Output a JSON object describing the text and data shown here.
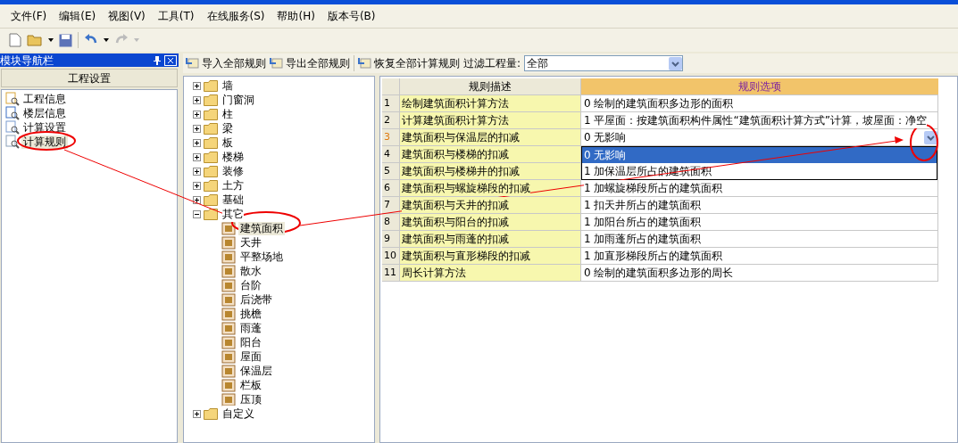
{
  "menu": [
    "文件(F)",
    "编辑(E)",
    "视图(V)",
    "工具(T)",
    "在线服务(S)",
    "帮助(H)",
    "版本号(B)"
  ],
  "nav_panel": {
    "title": "模块导航栏",
    "section": "工程设置",
    "items": [
      {
        "label": "工程信息",
        "selected": false
      },
      {
        "label": "楼层信息",
        "selected": false
      },
      {
        "label": "计算设置",
        "selected": false
      },
      {
        "label": "计算规则",
        "selected": true
      }
    ]
  },
  "rules_toolbar": {
    "buttons": [
      "导入全部规则",
      "导出全部规则",
      "恢复全部计算规则"
    ],
    "filter": {
      "label": "过滤工程量:",
      "value": "全部"
    }
  },
  "tree": [
    {
      "label": "墙",
      "expanded": false
    },
    {
      "label": "门窗洞",
      "expanded": false
    },
    {
      "label": "柱",
      "expanded": false
    },
    {
      "label": "梁",
      "expanded": false
    },
    {
      "label": "板",
      "expanded": false
    },
    {
      "label": "楼梯",
      "expanded": false
    },
    {
      "label": "装修",
      "expanded": false
    },
    {
      "label": "土方",
      "expanded": false
    },
    {
      "label": "基础",
      "expanded": false
    },
    {
      "label": "其它",
      "expanded": true,
      "children": [
        {
          "label": "建筑面积",
          "selected": true
        },
        {
          "label": "天井",
          "selected": false
        },
        {
          "label": "平整场地",
          "selected": false
        },
        {
          "label": "散水",
          "selected": false
        },
        {
          "label": "台阶",
          "selected": false
        },
        {
          "label": "后浇带",
          "selected": false
        },
        {
          "label": "挑檐",
          "selected": false
        },
        {
          "label": "雨蓬",
          "selected": false
        },
        {
          "label": "阳台",
          "selected": false
        },
        {
          "label": "屋面",
          "selected": false
        },
        {
          "label": "保温层",
          "selected": false
        },
        {
          "label": "栏板",
          "selected": false
        },
        {
          "label": "压顶",
          "selected": false
        }
      ]
    },
    {
      "label": "自定义",
      "expanded": false
    }
  ],
  "grid": {
    "columns": [
      "规则描述",
      "规则选项"
    ],
    "rows": [
      {
        "number": "1",
        "description": "绘制建筑面积计算方法",
        "option": "0 绘制的建筑面积多边形的面积",
        "selected": false
      },
      {
        "number": "2",
        "description": "计算建筑面积计算方法",
        "option": "1 平屋面：按建筑面积构件属性“建筑面积计算方式”计算，坡屋面：净空",
        "selected": false
      },
      {
        "number": "3",
        "description": "建筑面积与保温层的扣减",
        "option": "0  无影响",
        "selected": true,
        "dropdown": [
          {
            "label": "0  无影响",
            "selected": true
          },
          {
            "label": "1 加保温层所占的建筑面积",
            "selected": false
          }
        ]
      },
      {
        "number": "4",
        "description": "建筑面积与楼梯的扣减",
        "selected": false
      },
      {
        "number": "5",
        "description": "建筑面积与楼梯井的扣减",
        "selected": false
      },
      {
        "number": "6",
        "description": "建筑面积与螺旋梯段的扣减",
        "option": "1 加螺旋梯段所占的建筑面积",
        "selected": false
      },
      {
        "number": "7",
        "description": "建筑面积与天井的扣减",
        "option": "1 扣天井所占的建筑面积",
        "selected": false
      },
      {
        "number": "8",
        "description": "建筑面积与阳台的扣减",
        "option": "1 加阳台所占的建筑面积",
        "selected": false
      },
      {
        "number": "9",
        "description": "建筑面积与雨蓬的扣减",
        "option": "1 加雨蓬所占的建筑面积",
        "selected": false
      },
      {
        "number": "10",
        "description": "建筑面积与直形梯段的扣减",
        "option": "1 加直形梯段所占的建筑面积",
        "selected": false
      },
      {
        "number": "11",
        "description": "周长计算方法",
        "option": "0 绘制的建筑面积多边形的周长",
        "selected": false
      }
    ]
  }
}
